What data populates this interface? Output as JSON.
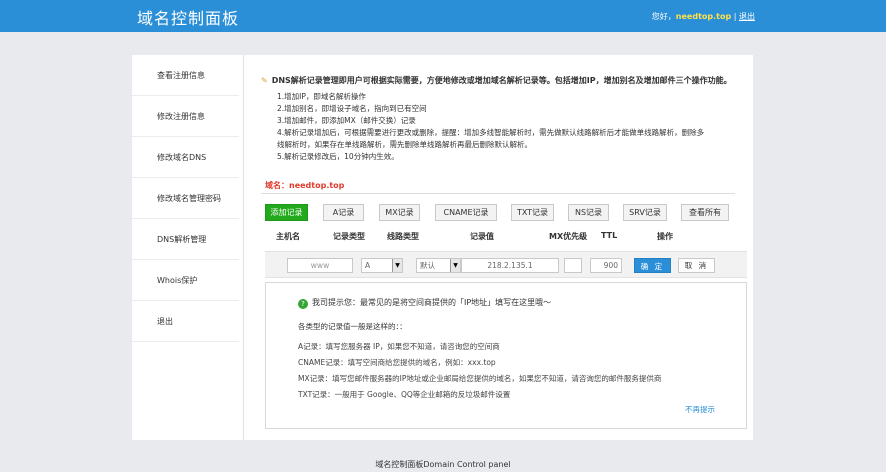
{
  "header": {
    "title": "域名控制面板",
    "greeting": "您好，",
    "username": "needtop.top",
    "separator": "|",
    "logout": "退出"
  },
  "sidebar": {
    "items": [
      {
        "label": "查看注册信息"
      },
      {
        "label": "修改注册信息"
      },
      {
        "label": "修改域名DNS"
      },
      {
        "label": "修改域名管理密码"
      },
      {
        "label": "DNS解析管理"
      },
      {
        "label": "Whois保护"
      },
      {
        "label": "退出"
      }
    ]
  },
  "notice": {
    "heading": "DNS解析记录管理即用户可根据实际需要，方便地修改或增加域名解析记录等。包括增加IP，增加别名及增加邮件三个操作功能。",
    "lines": [
      "1.增加IP，即域名解析操作",
      "2.增加别名，即增设子域名，指向到已有空间",
      "3.增加邮件，即添加MX（邮件交换）记录",
      "4.解析记录增加后，可根据需要进行更改或删除，提醒：增加多线智能解析时，需先做默认线路解析后才能做单线路解析，删除多",
      "线解析时，如果存在单线路解析，需先删除单线路解析再最后删除默认解析。",
      "5.解析记录修改后，10分钟内生效。"
    ]
  },
  "domain": {
    "label": "域名：",
    "value": "needtop.top"
  },
  "tabs": [
    {
      "label": "添加记录"
    },
    {
      "label": "A记录"
    },
    {
      "label": "MX记录"
    },
    {
      "label": "CNAME记录"
    },
    {
      "label": "TXT记录"
    },
    {
      "label": "NS记录"
    },
    {
      "label": "SRV记录"
    },
    {
      "label": "查看所有"
    }
  ],
  "columns": [
    "主机名",
    "记录类型",
    "线路类型",
    "记录值",
    "MX优先级",
    "TTL",
    "操作"
  ],
  "form": {
    "host_value": "www",
    "record_type": "A",
    "line_type": "默认",
    "record_value": "218.2.135.1",
    "mx_priority": "",
    "ttl": "900",
    "confirm_label": "确 定",
    "cancel_label": "取 消"
  },
  "tip": {
    "title": "我司提示您：最常见的是将空间商提供的「IP地址」填写在这里哦～",
    "subtitle": "各类型的记录值一般是这样的：：",
    "lines": [
      "A记录：填写您服务器 IP，如果您不知道，请咨询您的空间商",
      "CNAME记录：填写空间商给您提供的域名，例如：xxx.top",
      "MX记录：填写您邮件服务器的IP地址或企业邮局给您提供的域名，如果您不知道，请咨询您的邮件服务提供商",
      "TXT记录：一般用于 Google、QQ等企业邮箱的反垃圾邮件设置"
    ],
    "dismiss": "不再提示"
  },
  "footer": {
    "text": "域名控制面板Domain Control panel"
  },
  "colors": {
    "header_bg": "#2b8fd8",
    "username": "#ffe14a",
    "domain_label": "#e23b2d",
    "add_button": "#22a91c",
    "confirm_button": "#2b8fd8",
    "page_bg": "#e9eaed"
  },
  "icons": {
    "notice": "pencil-icon",
    "tip": "question-icon",
    "select_arrow": "dropdown-arrow-icon"
  }
}
